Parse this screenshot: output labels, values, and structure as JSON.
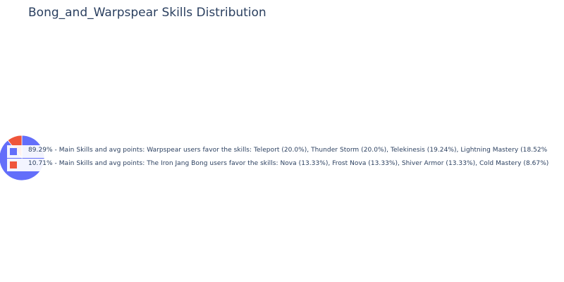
{
  "chart_data": {
    "type": "pie",
    "title": "Bong_and_Warpspear Skills Distribution",
    "slices": [
      {
        "label": "89.29% - Main Skills and avg points: Warpspear users favor the skills: Teleport (20.0%), Thunder Storm (20.0%), Telekinesis (19.24%), Lightning Mastery (18.52%",
        "value": 89.29,
        "color": "#636efa"
      },
      {
        "label": "10.71% - Main Skills and avg points: The Iron Jang Bong users favor the skills: Nova (13.33%), Frost Nova (13.33%), Shiver Armor (13.33%), Cold Mastery (8.67%)",
        "value": 10.71,
        "color": "#ef553b"
      }
    ],
    "legend_placement": "left"
  }
}
